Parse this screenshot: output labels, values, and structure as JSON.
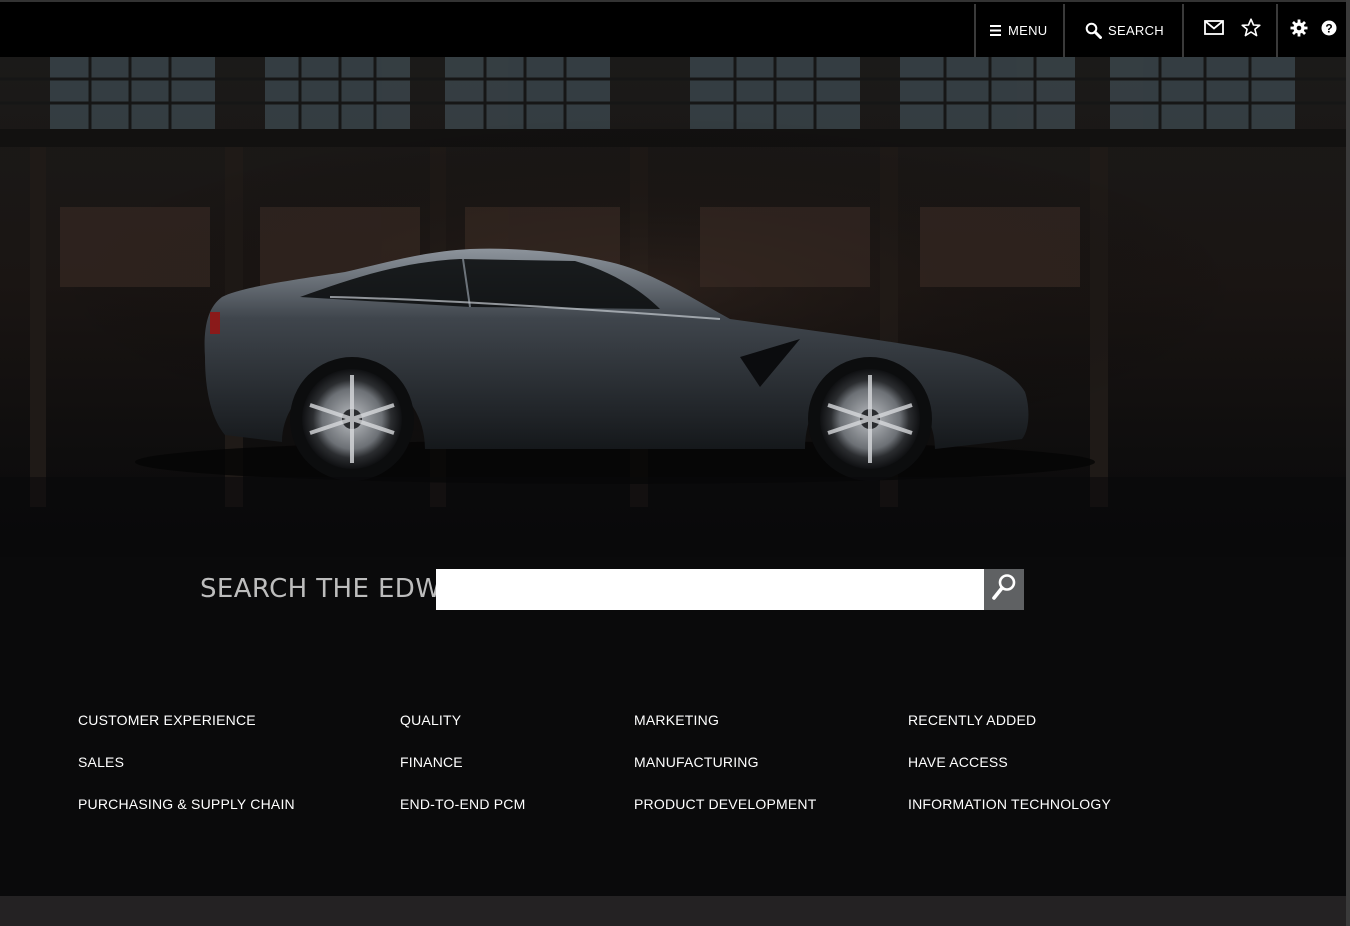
{
  "topbar": {
    "menu_label": "MENU",
    "menu_icon": "hamburger-icon",
    "search_label": "SEARCH",
    "search_icon": "magnifier-icon",
    "icons": [
      "mail-icon",
      "star-icon",
      "gear-icon",
      "help-icon"
    ]
  },
  "search": {
    "label": "SEARCH THE EDW",
    "value": "",
    "placeholder": "",
    "button_icon": "search-icon"
  },
  "categories": {
    "col1": [
      "CUSTOMER EXPERIENCE",
      "SALES",
      "PURCHASING & SUPPLY CHAIN"
    ],
    "col2": [
      "QUALITY",
      "FINANCE",
      "END-TO-END PCM"
    ],
    "col3": [
      "MARKETING",
      "MANUFACTURING",
      "PRODUCT DEVELOPMENT"
    ],
    "col4": [
      "RECENTLY ADDED",
      "HAVE ACCESS",
      "INFORMATION TECHNOLOGY"
    ]
  },
  "colors": {
    "background": "#0a0a0b",
    "topbar": "#000000",
    "search_button": "#5f6163",
    "footer": "#242223"
  }
}
